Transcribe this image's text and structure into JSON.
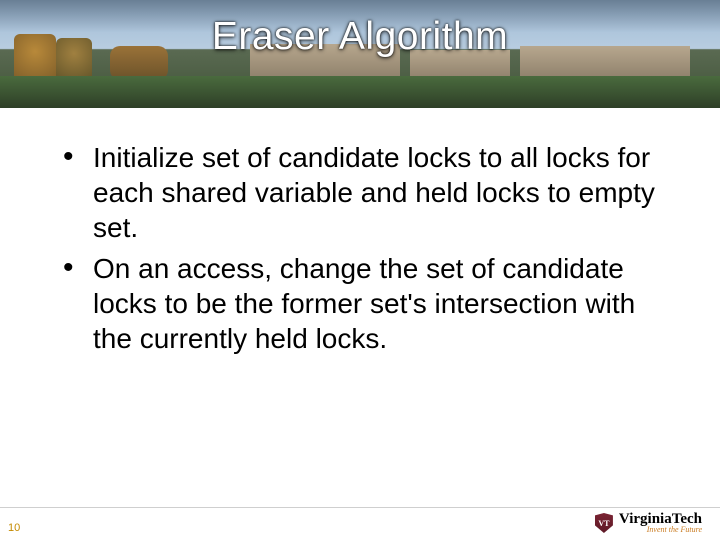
{
  "title": "Eraser Algorithm",
  "bullets": [
    "Initialize set of candidate locks to all locks for each shared variable and held locks to empty set.",
    "On an access, change the set of candidate locks to be the former set's intersection with the currently held locks."
  ],
  "page_number": "10",
  "logo": {
    "shield_text": "VT",
    "name": "VirginiaTech",
    "tagline": "Invent the Future"
  }
}
